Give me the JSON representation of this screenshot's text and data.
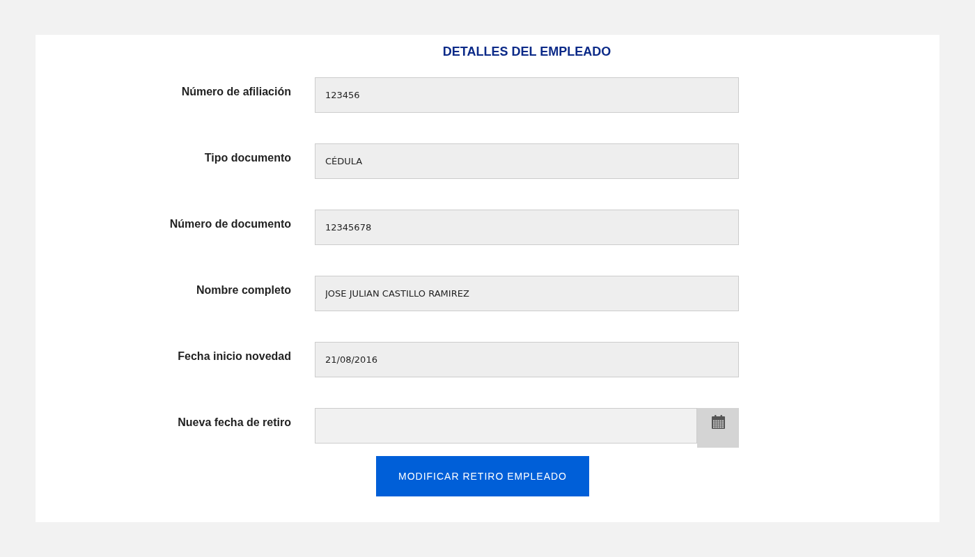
{
  "title": "DETALLES DEL EMPLEADO",
  "fields": [
    {
      "label": "Número de afiliación",
      "kind": "text",
      "value": "123456"
    },
    {
      "label": "Tipo documento",
      "kind": "text",
      "value": "CÉDULA"
    },
    {
      "label": "Número de documento",
      "kind": "text",
      "value": "12345678"
    },
    {
      "label": "Nombre completo",
      "kind": "text",
      "value": "JOSE JULIAN CASTILLO RAMIREZ"
    },
    {
      "label": "Fecha inicio novedad",
      "kind": "text",
      "value": "21/08/2016"
    },
    {
      "label": "Nueva fecha de retiro",
      "kind": "date"
    }
  ],
  "submit_button": {
    "label": "MODIFICAR RETIRO EMPLEADO"
  }
}
